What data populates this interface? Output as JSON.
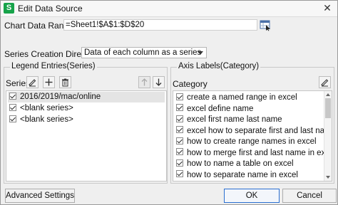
{
  "window": {
    "title": "Edit Data Source",
    "app_icon_letter": "S"
  },
  "chart_range": {
    "label": "Chart Data Range:",
    "value": "=Sheet1!$A$1:$D$20"
  },
  "direction": {
    "label": "Series Creation Direction:",
    "selected": "Data of each column as a series"
  },
  "legend": {
    "group_title": "Legend Entries(Series)",
    "toolbar_label": "Series",
    "items": [
      {
        "label": "2016/2019/mac/online",
        "checked": true
      },
      {
        "label": "<blank series>",
        "checked": true
      },
      {
        "label": "<blank series>",
        "checked": true
      }
    ]
  },
  "axis": {
    "group_title": "Axis Labels(Category)",
    "toolbar_label": "Category",
    "items": [
      {
        "label": "create a named range in excel",
        "checked": true
      },
      {
        "label": "excel define name",
        "checked": true
      },
      {
        "label": "excel first name last name",
        "checked": true
      },
      {
        "label": "excel how to separate first and last name",
        "checked": true
      },
      {
        "label": "how to create range names in excel",
        "checked": true
      },
      {
        "label": "how to merge first and last name in excel",
        "checked": true
      },
      {
        "label": "how to name a table on excel",
        "checked": true
      },
      {
        "label": "how to separate name in excel",
        "checked": true
      }
    ]
  },
  "buttons": {
    "advanced": "Advanced Settings >>",
    "ok": "OK",
    "cancel": "Cancel"
  }
}
